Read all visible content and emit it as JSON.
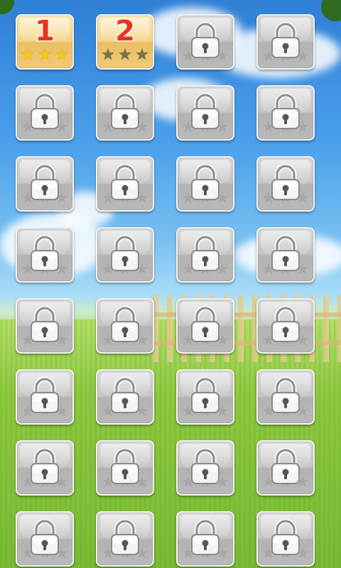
{
  "levels": [
    {
      "label": "1",
      "locked": false,
      "stars": 3
    },
    {
      "label": "2",
      "locked": false,
      "stars": 0
    },
    {
      "label": "",
      "locked": true,
      "stars": 0
    },
    {
      "label": "",
      "locked": true,
      "stars": 0
    },
    {
      "label": "",
      "locked": true,
      "stars": 0
    },
    {
      "label": "",
      "locked": true,
      "stars": 0
    },
    {
      "label": "",
      "locked": true,
      "stars": 0
    },
    {
      "label": "",
      "locked": true,
      "stars": 0
    },
    {
      "label": "",
      "locked": true,
      "stars": 0
    },
    {
      "label": "",
      "locked": true,
      "stars": 0
    },
    {
      "label": "",
      "locked": true,
      "stars": 0
    },
    {
      "label": "",
      "locked": true,
      "stars": 0
    },
    {
      "label": "",
      "locked": true,
      "stars": 0
    },
    {
      "label": "",
      "locked": true,
      "stars": 0
    },
    {
      "label": "",
      "locked": true,
      "stars": 0
    },
    {
      "label": "",
      "locked": true,
      "stars": 0
    },
    {
      "label": "",
      "locked": true,
      "stars": 0
    },
    {
      "label": "",
      "locked": true,
      "stars": 0
    },
    {
      "label": "",
      "locked": true,
      "stars": 0
    },
    {
      "label": "",
      "locked": true,
      "stars": 0
    },
    {
      "label": "",
      "locked": true,
      "stars": 0
    },
    {
      "label": "",
      "locked": true,
      "stars": 0
    },
    {
      "label": "",
      "locked": true,
      "stars": 0
    },
    {
      "label": "",
      "locked": true,
      "stars": 0
    },
    {
      "label": "",
      "locked": true,
      "stars": 0
    },
    {
      "label": "",
      "locked": true,
      "stars": 0
    },
    {
      "label": "",
      "locked": true,
      "stars": 0
    },
    {
      "label": "",
      "locked": true,
      "stars": 0
    },
    {
      "label": "",
      "locked": true,
      "stars": 0
    },
    {
      "label": "",
      "locked": true,
      "stars": 0
    },
    {
      "label": "",
      "locked": true,
      "stars": 0
    },
    {
      "label": "",
      "locked": true,
      "stars": 0
    }
  ],
  "icons": {
    "locked": "padlock-icon",
    "star": "star-icon"
  },
  "colors": {
    "level_number": "#e8331e",
    "star_gold": "#f7c81b",
    "star_empty": "#7b6e50",
    "tile_unlocked": "#f4d388",
    "tile_locked": "#c4c4c4"
  }
}
